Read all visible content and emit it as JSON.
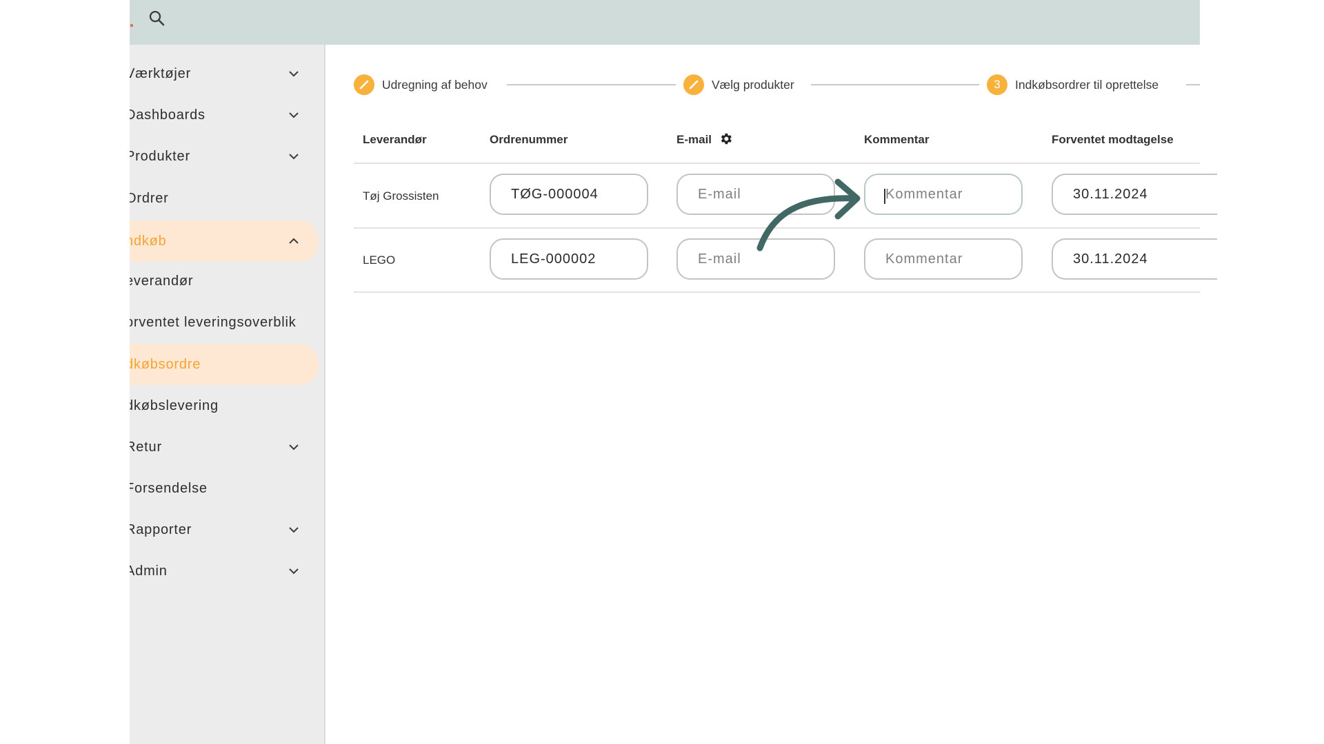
{
  "sidebar": {
    "items": [
      {
        "label": "Værktøjer",
        "has_chevron": true,
        "chevron": "down"
      },
      {
        "label": "Dashboards",
        "has_chevron": true,
        "chevron": "down"
      },
      {
        "label": "Produkter",
        "has_chevron": true,
        "chevron": "down"
      },
      {
        "label": "Ordrer",
        "has_chevron": false
      },
      {
        "label": "ndkøb",
        "has_chevron": true,
        "chevron": "up",
        "active": true
      },
      {
        "label": "everandør",
        "has_chevron": false
      },
      {
        "label": "orventet leveringsoverblik",
        "has_chevron": false
      },
      {
        "label": "dkøbsordre",
        "has_chevron": false,
        "active": true
      },
      {
        "label": "dkøbslevering",
        "has_chevron": false
      },
      {
        "label": "Retur",
        "has_chevron": true,
        "chevron": "down"
      },
      {
        "label": "Forsendelse",
        "has_chevron": false
      },
      {
        "label": "Rapporter",
        "has_chevron": true,
        "chevron": "down"
      },
      {
        "label": "Admin",
        "has_chevron": true,
        "chevron": "down"
      }
    ]
  },
  "stepper": {
    "steps": [
      {
        "label": "Udregning af behov",
        "state": "done",
        "icon": "pencil-icon"
      },
      {
        "label": "Vælg produkter",
        "state": "done",
        "icon": "pencil-icon"
      },
      {
        "label": "Indkøbsordrer til oprettelse",
        "state": "current",
        "number": "3"
      }
    ]
  },
  "table": {
    "headers": {
      "supplier": "Leverandør",
      "order_number": "Ordrenummer",
      "email": "E-mail",
      "comment": "Kommentar",
      "expected": "Forventet modtagelse"
    },
    "rows": [
      {
        "supplier": "Tøj Grossisten",
        "order_number": "TØG-000004",
        "email_placeholder": "E-mail",
        "comment_placeholder": "Kommentar",
        "expected": "30.11.2024"
      },
      {
        "supplier": "LEGO",
        "order_number": "LEG-000002",
        "email_placeholder": "E-mail",
        "comment_placeholder": "Kommentar",
        "expected": "30.11.2024"
      }
    ]
  },
  "colors": {
    "accent": "#f8b13b",
    "active_bg": "#ffe8d3",
    "topbar": "#d0dcda",
    "annotation_arrow": "#426865"
  },
  "annotation": {
    "icon": "curved-arrow-icon"
  }
}
